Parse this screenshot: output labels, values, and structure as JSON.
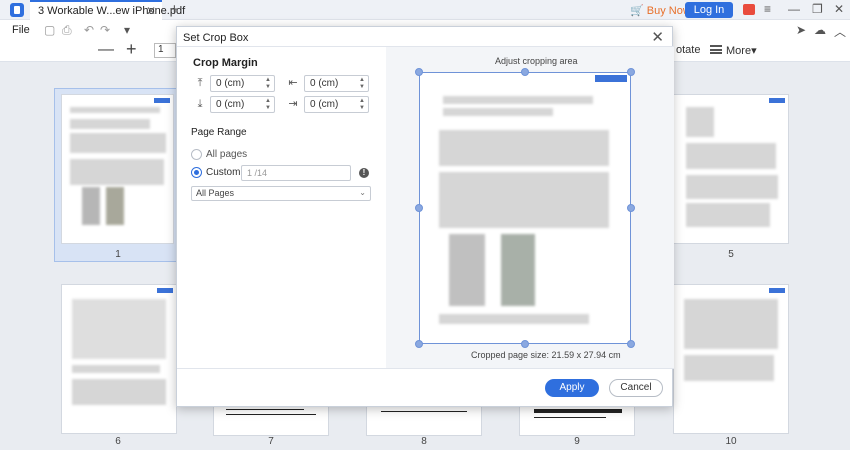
{
  "titlebar": {
    "tab_title": "3 Workable W...ew iPhone.pdf",
    "tab_close": "✕",
    "tab_add": "+",
    "buy_now": "Buy Now",
    "login": "Log In",
    "minimize": "—",
    "maximize": "❐",
    "close": "✕"
  },
  "menubar": {
    "file": "File"
  },
  "toolbar": {
    "zoom_out": "—",
    "zoom_in": "+",
    "page": "1",
    "rotate": "otate",
    "more": "More"
  },
  "thumbnails": [
    {
      "label": "1"
    },
    {
      "label": "5"
    },
    {
      "label": "6"
    },
    {
      "label": "7"
    },
    {
      "label": "8"
    },
    {
      "label": "9"
    },
    {
      "label": "10"
    }
  ],
  "dialog": {
    "title": "Set Crop Box",
    "close": "✕",
    "crop_margin": {
      "title": "Crop Margin",
      "top": "0 (cm)",
      "left": "0 (cm)",
      "bottom": "0 (cm)",
      "right": "0 (cm)"
    },
    "page_range": {
      "title": "Page Range",
      "all_pages": "All pages",
      "custom": "Custom",
      "custom_value": "1 /14",
      "info": "!",
      "select_value": "All Pages",
      "selected_option": "custom"
    },
    "preview": {
      "label": "Adjust cropping area",
      "cropped_size": "Cropped page size: 21.59 x 27.94 cm"
    },
    "buttons": {
      "apply": "Apply",
      "cancel": "Cancel"
    }
  },
  "colors": {
    "accent": "#2f6fde",
    "buy_now": "#e8702a"
  }
}
